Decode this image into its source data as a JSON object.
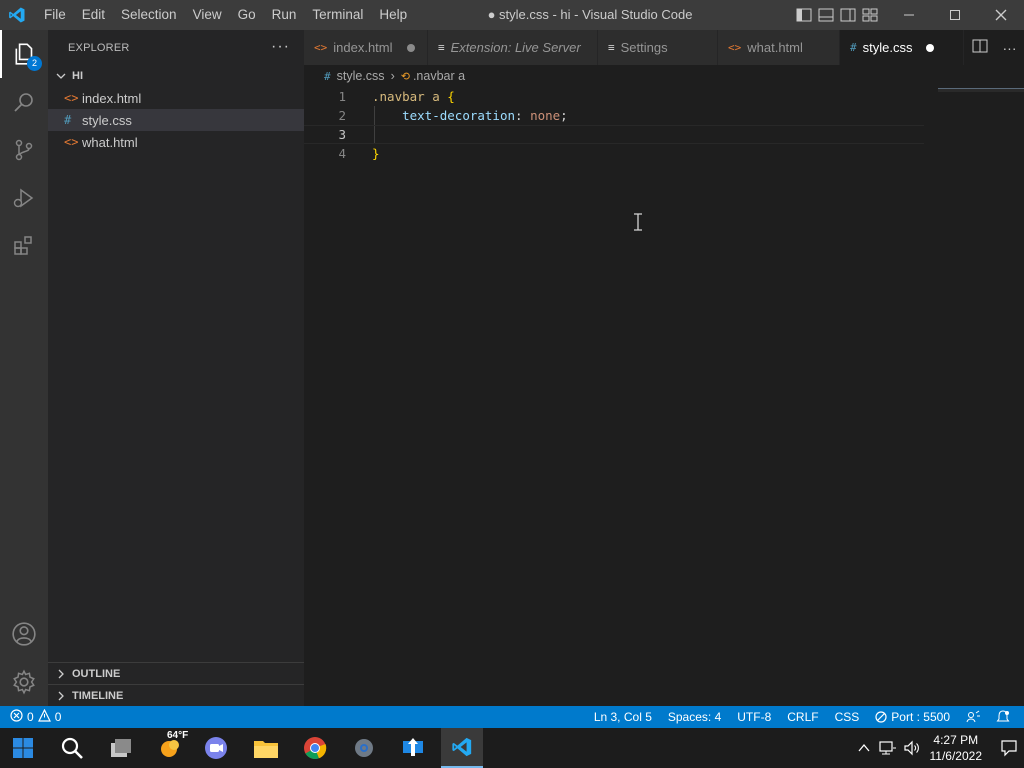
{
  "titlebar": {
    "menu": [
      "File",
      "Edit",
      "Selection",
      "View",
      "Go",
      "Run",
      "Terminal",
      "Help"
    ],
    "window_title": "● style.css - hi - Visual Studio Code"
  },
  "activity_bar": {
    "items": [
      "explorer-icon",
      "search-icon",
      "source-control-icon",
      "run-debug-icon",
      "extensions-icon"
    ],
    "explorer_badge": "2",
    "bottom_items": [
      "account-icon",
      "manage-gear-icon"
    ]
  },
  "sidebar": {
    "title": "EXPLORER",
    "folder": "HI",
    "files": [
      {
        "name": "index.html",
        "type": "html",
        "icon": "<>"
      },
      {
        "name": "style.css",
        "type": "css",
        "icon": "#"
      },
      {
        "name": "what.html",
        "type": "html",
        "icon": "<>"
      }
    ],
    "outline_label": "OUTLINE",
    "timeline_label": "TIMELINE"
  },
  "tabs": [
    {
      "label": "index.html",
      "icon": "<>",
      "dirty": true
    },
    {
      "label": "Extension: Live Server",
      "icon": "≡",
      "italic": true
    },
    {
      "label": "Settings",
      "icon": "≡"
    },
    {
      "label": "what.html",
      "icon": "<>"
    },
    {
      "label": "style.css",
      "icon": "#",
      "dirty": true,
      "active": true
    }
  ],
  "breadcrumb": {
    "file": "style.css",
    "symbol": ".navbar a"
  },
  "editor": {
    "lines": [
      {
        "number": "1",
        "selector": ".navbar a",
        "brace_open": "{"
      },
      {
        "number": "2",
        "property": "text-decoration",
        "colon": ":",
        "value": "none",
        "semicolon": ";"
      },
      {
        "number": "3"
      },
      {
        "number": "4",
        "brace_close": "}"
      }
    ]
  },
  "statusbar": {
    "errors": "0",
    "warnings": "0",
    "position": "Ln 3, Col 5",
    "spaces": "Spaces: 4",
    "encoding": "UTF-8",
    "eol": "CRLF",
    "language": "CSS",
    "port": "Port : 5500"
  },
  "taskbar": {
    "weather": "64°F",
    "time": "4:27 PM",
    "date": "11/6/2022"
  },
  "colors": {
    "accent": "#007acc",
    "titlebar": "#3c3c3c",
    "sidebar": "#252526",
    "editor_bg": "#1e1e1e"
  }
}
